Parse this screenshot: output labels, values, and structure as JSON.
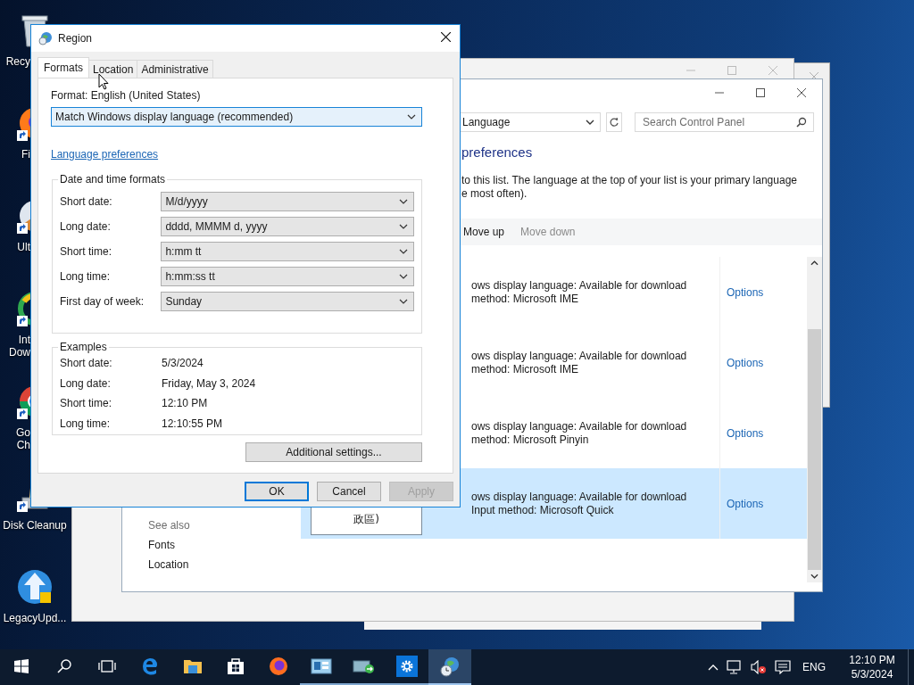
{
  "desktop_icons": [
    {
      "kind": "recycle",
      "lines": [
        "Recy"
      ],
      "clipped": true,
      "shortcut": false
    },
    {
      "kind": "firefox",
      "lines": [
        "Fi"
      ],
      "clipped": true,
      "shortcut": true
    },
    {
      "kind": "disc",
      "lines": [
        "Ult"
      ],
      "clipped": true,
      "shortcut": true
    },
    {
      "kind": "download",
      "lines": [
        "Int",
        "Dow"
      ],
      "clipped": true,
      "shortcut": true
    },
    {
      "kind": "chrome",
      "lines": [
        "Go",
        "Ch"
      ],
      "clipped": true,
      "shortcut": true
    },
    {
      "kind": "cleanup",
      "lines": [
        "Disk Cleanup"
      ],
      "clipped": false,
      "shortcut": true
    },
    {
      "kind": "update",
      "lines": [
        "LegacyUpd..."
      ],
      "clipped": false,
      "shortcut": false
    }
  ],
  "control_panel": {
    "address": "Language",
    "search_placeholder": "Search Control Panel",
    "heading": "preferences",
    "description_lines": [
      "to this list. The language at the top of your list is your primary language",
      "e most often)."
    ],
    "toolbar": [
      {
        "label": "Move up",
        "disabled": false
      },
      {
        "label": "Move down",
        "disabled": true
      }
    ],
    "languages": [
      {
        "details": [
          "ows display language: Available for download",
          "method: Microsoft IME"
        ],
        "options": "Options",
        "selected": false
      },
      {
        "details": [
          "ows display language: Available for download",
          "method: Microsoft IME"
        ],
        "options": "Options",
        "selected": false
      },
      {
        "details": [
          "ows display language: Available for download",
          "method: Microsoft Pinyin"
        ],
        "options": "Options",
        "selected": false
      },
      {
        "name": "政區)",
        "details": [
          "ows display language: Available for download",
          "Input method: Microsoft Quick"
        ],
        "options": "Options",
        "selected": true
      }
    ],
    "see_also": {
      "title": "See also",
      "links": [
        "Fonts",
        "Location"
      ]
    }
  },
  "region_dialog": {
    "title": "Region",
    "tabs": [
      {
        "label": "Formats",
        "selected": true
      },
      {
        "label": "Location",
        "selected": false
      },
      {
        "label": "Administrative",
        "selected": false
      }
    ],
    "format_label": "Format: English (United States)",
    "format_value": "Match Windows display language (recommended)",
    "link": "Language preferences",
    "formats_group": {
      "title": "Date and time formats",
      "rows": [
        {
          "label": "Short date:",
          "value": "M/d/yyyy"
        },
        {
          "label": "Long date:",
          "value": "dddd, MMMM d, yyyy"
        },
        {
          "label": "Short time:",
          "value": "h:mm tt"
        },
        {
          "label": "Long time:",
          "value": "h:mm:ss tt"
        },
        {
          "label": "First day of week:",
          "value": "Sunday"
        }
      ]
    },
    "examples_group": {
      "title": "Examples",
      "rows": [
        {
          "label": "Short date:",
          "value": "5/3/2024"
        },
        {
          "label": "Long date:",
          "value": "Friday, May 3, 2024"
        },
        {
          "label": "Short time:",
          "value": "12:10 PM"
        },
        {
          "label": "Long time:",
          "value": "12:10:55 PM"
        }
      ]
    },
    "additional_button": "Additional settings...",
    "buttons": [
      {
        "label": "OK",
        "kind": "default",
        "disabled": false
      },
      {
        "label": "Cancel",
        "kind": "normal",
        "disabled": false
      },
      {
        "label": "Apply",
        "kind": "normal",
        "disabled": true
      }
    ]
  },
  "taskbar": {
    "items": [
      {
        "kind": "start",
        "running": false,
        "active": false
      },
      {
        "kind": "search",
        "running": false,
        "active": false
      },
      {
        "kind": "taskview",
        "running": false,
        "active": false
      },
      {
        "kind": "edge",
        "running": false,
        "active": false
      },
      {
        "kind": "explorer",
        "running": false,
        "active": false
      },
      {
        "kind": "store",
        "running": false,
        "active": false
      },
      {
        "kind": "firefox",
        "running": false,
        "active": false
      },
      {
        "kind": "panel",
        "running": true,
        "active": false
      },
      {
        "kind": "network",
        "running": true,
        "active": false
      },
      {
        "kind": "settings",
        "running": true,
        "active": false
      },
      {
        "kind": "region",
        "running": true,
        "active": true
      }
    ],
    "language": "ENG",
    "time": "12:10 PM",
    "date": "5/3/2024"
  }
}
